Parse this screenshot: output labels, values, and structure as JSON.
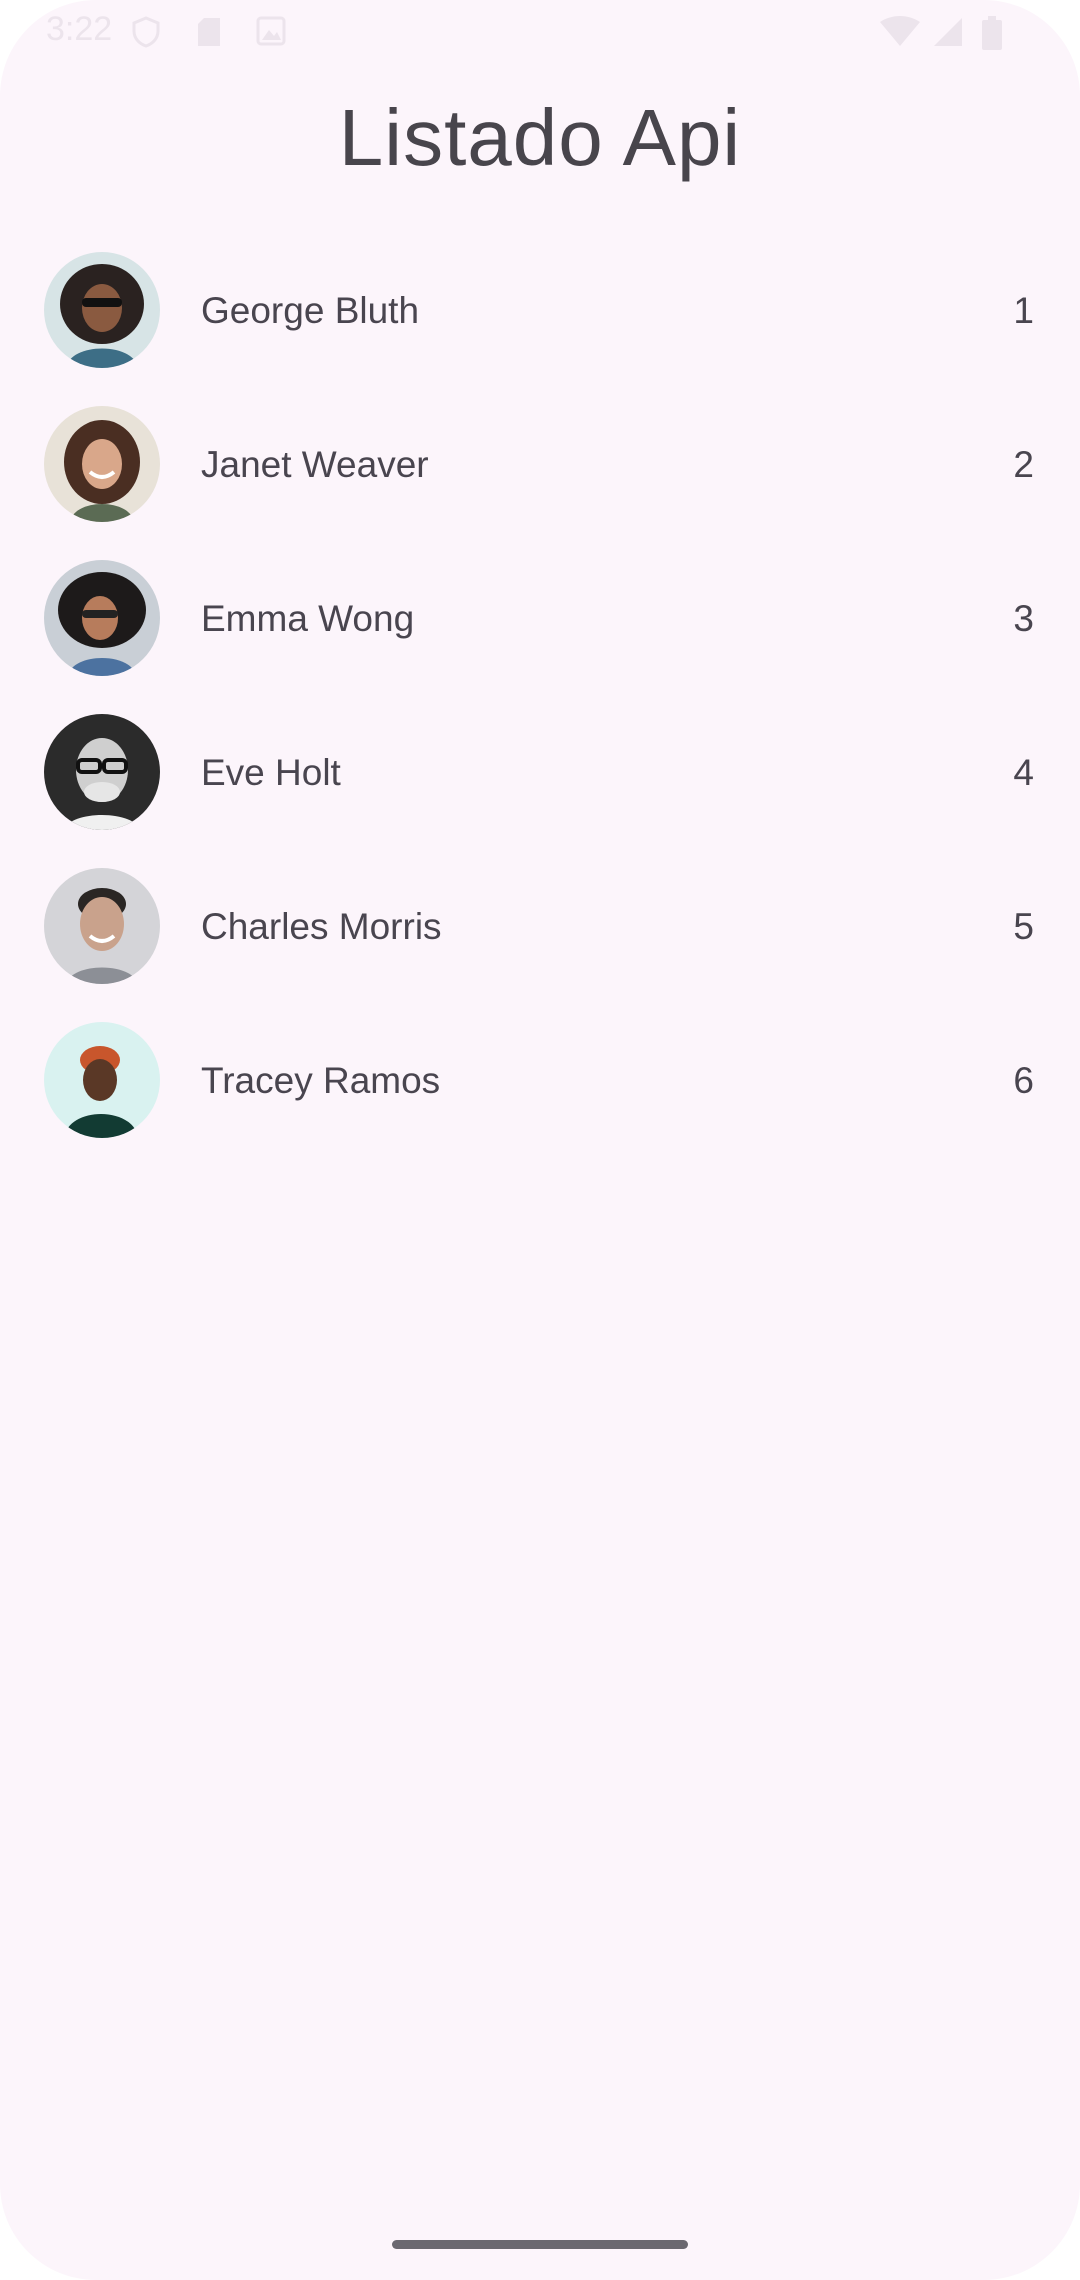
{
  "status_bar": {
    "time": "3:22",
    "icons": [
      "shield-icon",
      "sd-card-icon",
      "image-icon",
      "wifi-icon",
      "signal-icon",
      "battery-icon"
    ]
  },
  "header": {
    "title": "Listado Api"
  },
  "users": [
    {
      "name": "George Bluth",
      "id": "1"
    },
    {
      "name": "Janet Weaver",
      "id": "2"
    },
    {
      "name": "Emma Wong",
      "id": "3"
    },
    {
      "name": "Eve Holt",
      "id": "4"
    },
    {
      "name": "Charles Morris",
      "id": "5"
    },
    {
      "name": "Tracey Ramos",
      "id": "6"
    }
  ],
  "colors": {
    "background": "#fcf5fb",
    "text": "#49454f"
  }
}
